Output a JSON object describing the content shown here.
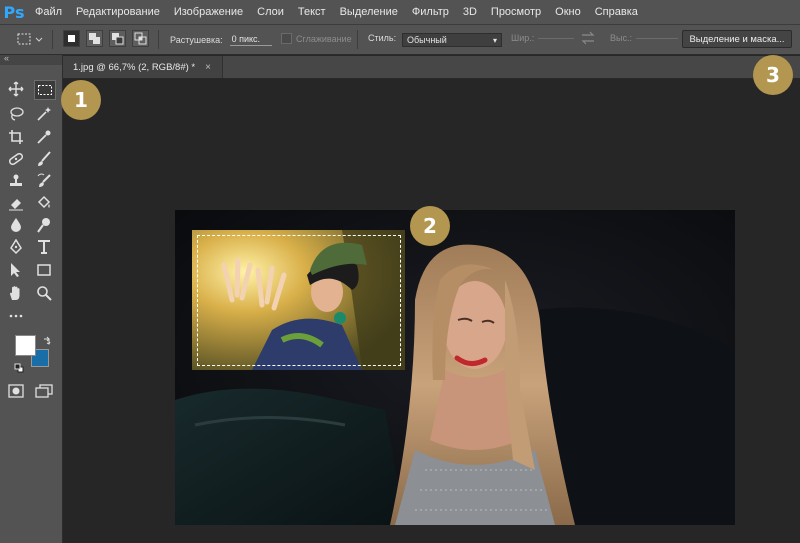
{
  "app": {
    "logo": "Ps"
  },
  "menu": [
    "Файл",
    "Редактирование",
    "Изображение",
    "Слои",
    "Текст",
    "Выделение",
    "Фильтр",
    "3D",
    "Просмотр",
    "Окно",
    "Справка"
  ],
  "options": {
    "feather_label": "Растушевка:",
    "feather_value": "0 пикс.",
    "antialias_label": "Сглаживание",
    "style_label": "Стиль:",
    "style_value": "Обычный",
    "width_label": "Шир.:",
    "height_label": "Выс.:",
    "select_mask_button": "Выделение и маска..."
  },
  "document": {
    "tab_title": "1.jpg @ 66,7% (2, RGB/8#) *",
    "close_symbol": "×"
  },
  "tools": {
    "collapse_glyph": "«",
    "items": [
      "move-tool",
      "rectangular-marquee-tool",
      "lasso-tool",
      "magic-wand-tool",
      "crop-tool",
      "eyedropper-tool",
      "spot-healing-brush-tool",
      "brush-tool",
      "clone-stamp-tool",
      "history-brush-tool",
      "eraser-tool",
      "paint-bucket-tool",
      "blur-tool",
      "dodge-tool",
      "pen-tool",
      "type-tool",
      "path-selection-tool",
      "rectangle-tool",
      "hand-tool",
      "zoom-tool",
      "more-tools",
      "foreground-color",
      "background-color",
      "quick-mask",
      "screen-mode"
    ]
  },
  "colors": {
    "foreground": "#ffffff",
    "background": "#1a6ea8",
    "accent": "#31a8ff",
    "marker": "#b3964f"
  },
  "markers": [
    "1",
    "2",
    "3"
  ]
}
